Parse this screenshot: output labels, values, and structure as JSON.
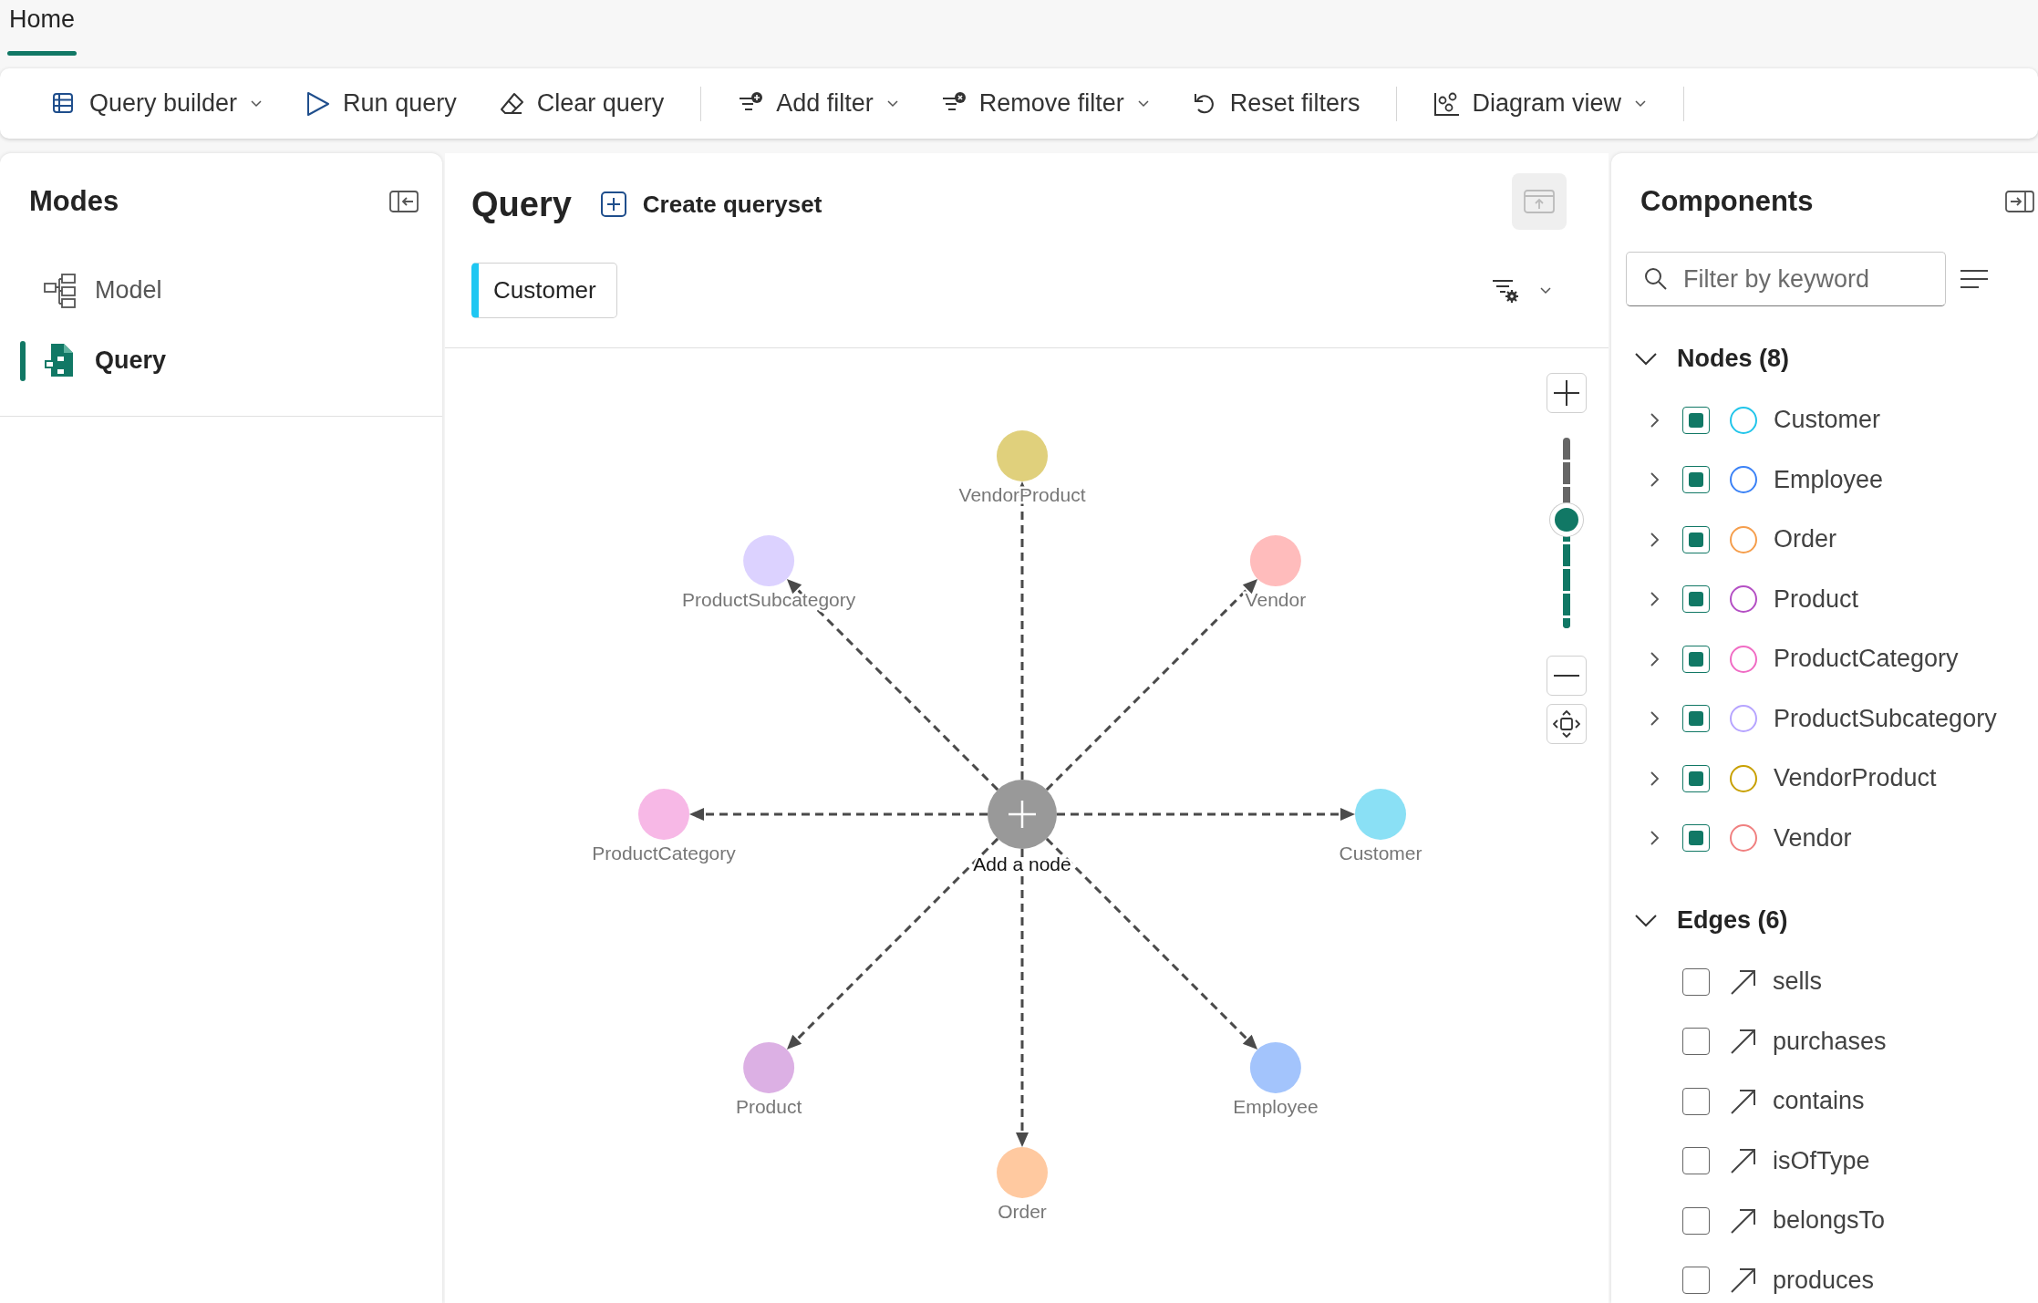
{
  "tabs": [
    {
      "label": "Home",
      "selected": true
    }
  ],
  "toolbar": {
    "groups": [
      [
        {
          "label": "Query builder",
          "dropdown": true
        },
        {
          "label": "Run query",
          "dropdown": false
        },
        {
          "label": "Clear query",
          "dropdown": false
        }
      ],
      [
        {
          "label": "Add filter",
          "dropdown": true
        },
        {
          "label": "Remove filter",
          "dropdown": true
        },
        {
          "label": "Reset filters",
          "dropdown": false
        }
      ],
      [
        {
          "label": "Diagram view",
          "dropdown": true
        }
      ]
    ]
  },
  "modes": {
    "title": "Modes",
    "items": [
      {
        "label": "Model",
        "selected": false
      },
      {
        "label": "Query",
        "selected": true
      }
    ]
  },
  "query": {
    "title": "Query",
    "create_button": "Create queryset",
    "chips": [
      {
        "label": "Customer",
        "color": "#1fc7f2"
      }
    ],
    "graph": {
      "center_label": "Add a node",
      "zoom": {
        "level": 0.57
      },
      "nodes": [
        {
          "label": "VendorProduct",
          "color": "#e0d07c"
        },
        {
          "label": "Vendor",
          "color": "#ffbcbc"
        },
        {
          "label": "Customer",
          "color": "#8ae0f5"
        },
        {
          "label": "Employee",
          "color": "#a3c4fc"
        },
        {
          "label": "Order",
          "color": "#ffc9a0"
        },
        {
          "label": "Product",
          "color": "#dcb0e4"
        },
        {
          "label": "ProductCategory",
          "color": "#f7b8e6"
        },
        {
          "label": "ProductSubcategory",
          "color": "#dcd2ff"
        }
      ]
    }
  },
  "components": {
    "title": "Components",
    "search": {
      "placeholder": "Filter by keyword"
    },
    "sections": [
      {
        "title": "Nodes (8)",
        "kind": "nodes",
        "expanded": true,
        "items": [
          {
            "label": "Customer",
            "checked": true,
            "expanded": false,
            "color": "#22c5ea"
          },
          {
            "label": "Employee",
            "checked": true,
            "expanded": false,
            "color": "#3b82f6"
          },
          {
            "label": "Order",
            "checked": true,
            "expanded": false,
            "color": "#f59e4c"
          },
          {
            "label": "Product",
            "checked": true,
            "expanded": false,
            "color": "#b44fc4"
          },
          {
            "label": "ProductCategory",
            "checked": true,
            "expanded": false,
            "color": "#f06cc4"
          },
          {
            "label": "ProductSubcategory",
            "checked": true,
            "expanded": false,
            "color": "#b6a4ff"
          },
          {
            "label": "VendorProduct",
            "checked": true,
            "expanded": false,
            "color": "#c8a000"
          },
          {
            "label": "Vendor",
            "checked": true,
            "expanded": false,
            "color": "#f08080"
          }
        ]
      },
      {
        "title": "Edges (6)",
        "kind": "edges",
        "expanded": true,
        "items": [
          {
            "label": "sells",
            "checked": false
          },
          {
            "label": "purchases",
            "checked": false
          },
          {
            "label": "contains",
            "checked": false
          },
          {
            "label": "isOfType",
            "checked": false
          },
          {
            "label": "belongsTo",
            "checked": false
          },
          {
            "label": "produces",
            "checked": false
          }
        ]
      }
    ]
  }
}
